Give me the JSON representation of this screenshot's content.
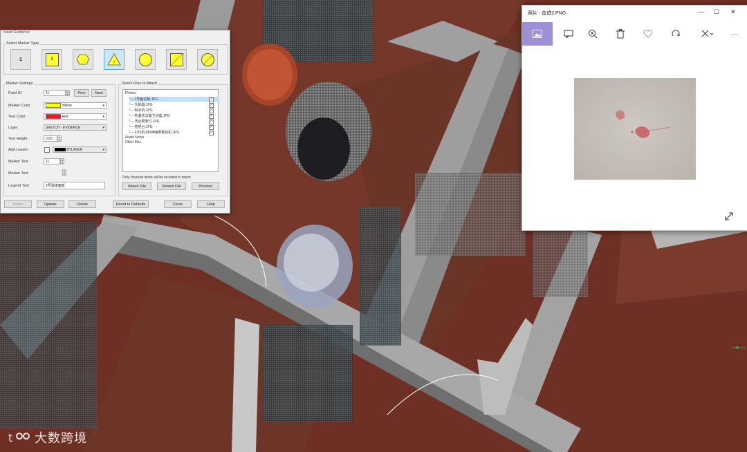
{
  "dialog": {
    "title": "Insert Evidence",
    "marker_type_group": "Select Marker Type",
    "marker_types": [
      {
        "name": "marker-type-plain-1",
        "label": "1",
        "color": "#ffffff",
        "selected": false
      },
      {
        "name": "marker-type-square-1",
        "label": "1",
        "color": "#ffff33",
        "selected": false
      },
      {
        "name": "marker-type-hexagon-1",
        "label": "1",
        "color": "#ffff33",
        "selected": false
      },
      {
        "name": "marker-type-triangle-1",
        "label": "1",
        "color": "#ffff33",
        "selected": true
      },
      {
        "name": "marker-type-circle-1",
        "label": "1",
        "color": "#ffff33",
        "selected": false
      },
      {
        "name": "marker-type-square-split",
        "label": "S\n1",
        "color": "#ffff33",
        "selected": false
      },
      {
        "name": "marker-type-circle-split",
        "label": "S\n1",
        "color": "#ffff33",
        "selected": false
      }
    ],
    "settings_group": "Marker Settings",
    "settings": {
      "point_id_label": "Point ID",
      "point_id_value": "11",
      "prev_label": "Prev",
      "next_label": "Next",
      "marker_color_label": "Marker Color",
      "marker_color_value": "Yellow",
      "marker_color_hex": "#ffff00",
      "text_color_label": "Text Color",
      "text_color_value": "Red",
      "text_color_hex": "#e02020",
      "layer_label": "Layer",
      "layer_value": "SKETCH - EVIDENCE",
      "text_height_label": "Text Height",
      "text_height_value": "0.05",
      "add_leader_label": "Add Leader",
      "add_leader_value": "BYLAYER",
      "marker_text_label": "Marker Text",
      "marker_text_value": "11",
      "marker_text2_label": "Marker Text",
      "legend_text_label": "Legend Text",
      "legend_text_value": "2号油漆面板"
    },
    "files_group": "Select Files to Attach",
    "files": {
      "photos_label": "Photos",
      "items": [
        {
          "label": "1号面试板.JPG",
          "checked": true
        },
        {
          "label": "功能器.JPG",
          "checked": true
        },
        {
          "label": "制冰机.JPG",
          "checked": true
        },
        {
          "label": "地漏式马桶卫浴套.JPG",
          "checked": true
        },
        {
          "label": "洗台着靠灯.JPG",
          "checked": true
        },
        {
          "label": "拖把台.JPG",
          "checked": true
        },
        {
          "label": "打印机-M5伸缩带着包机.JPG",
          "checked": true
        }
      ],
      "audio_label": "Audio Notes",
      "other_label": "Other files"
    },
    "note": "Only checked items will be included in report",
    "attach_label": "Attach File",
    "detach_label": "Detach File",
    "preview_label": "Preview",
    "insert_label": "Insert",
    "update_label": "Update",
    "delete_label": "Delete",
    "reset_label": "Reset to Defaults",
    "close_label": "Close",
    "help_label": "Help"
  },
  "photos_viewer": {
    "title": "照片 - 血迹2.PNG",
    "minimize": "—",
    "maximize": "☐",
    "close": "✕",
    "toolbar_more": "···",
    "accent": "#9f8fd6"
  },
  "watermark": {
    "text": "大数跨境"
  }
}
